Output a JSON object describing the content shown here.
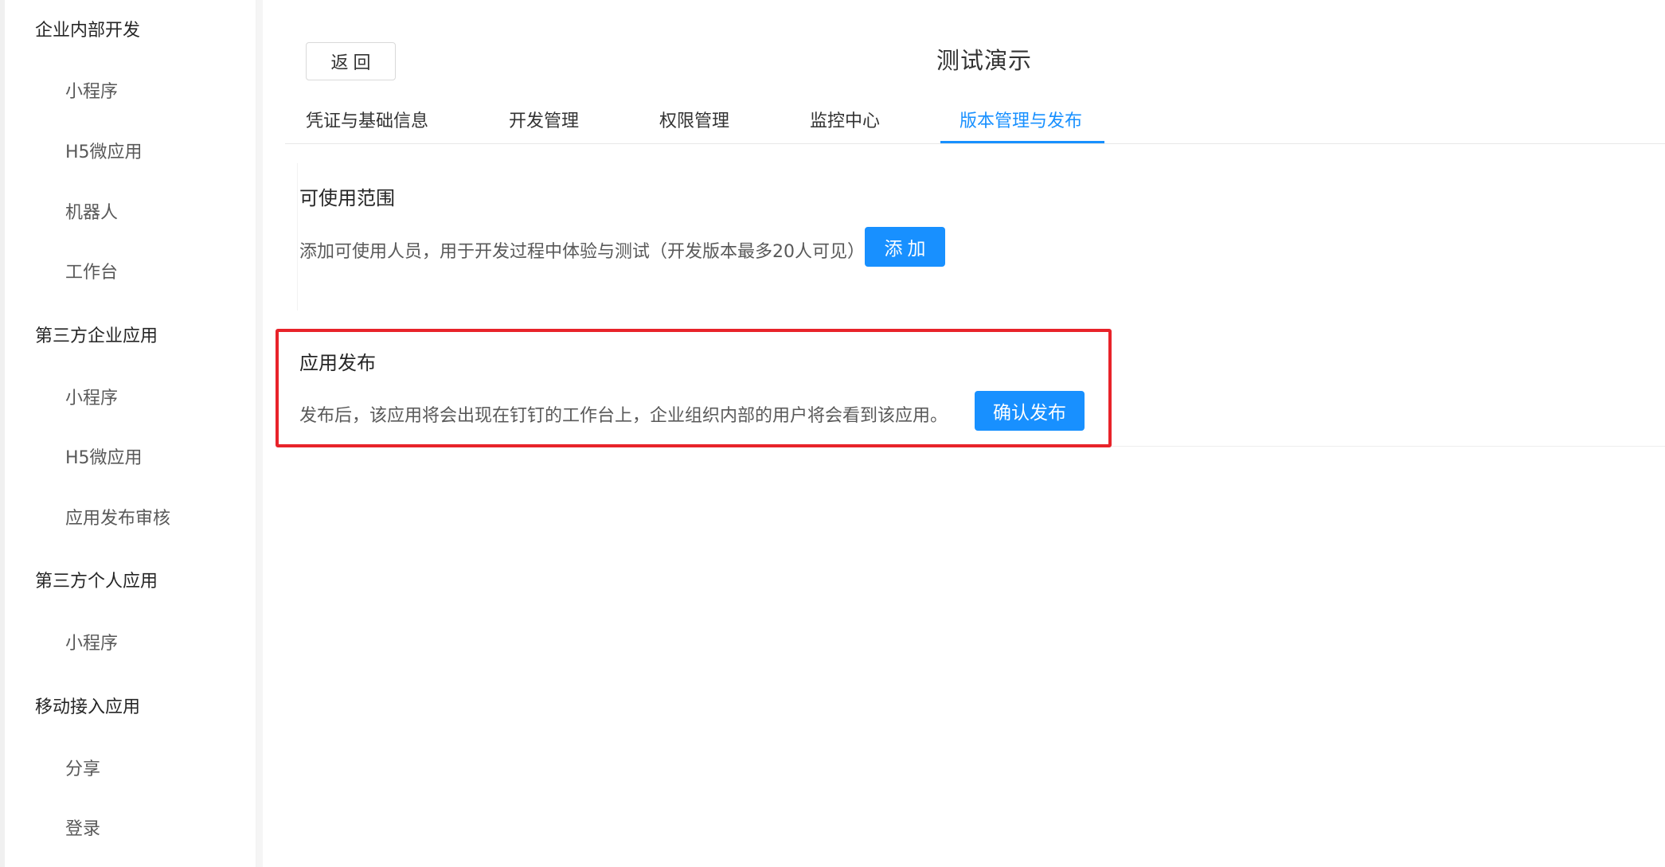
{
  "sidebar": {
    "groups": [
      {
        "label": "企业内部开发",
        "items": [
          "小程序",
          "H5微应用",
          "机器人",
          "工作台"
        ]
      },
      {
        "label": "第三方企业应用",
        "items": [
          "小程序",
          "H5微应用",
          "应用发布审核"
        ]
      },
      {
        "label": "第三方个人应用",
        "items": [
          "小程序"
        ]
      },
      {
        "label": "移动接入应用",
        "items": [
          "分享",
          "登录"
        ]
      }
    ]
  },
  "header": {
    "back_label": "返回",
    "title": "测试演示"
  },
  "tabs": [
    {
      "label": "凭证与基础信息",
      "active": false
    },
    {
      "label": "开发管理",
      "active": false
    },
    {
      "label": "权限管理",
      "active": false
    },
    {
      "label": "监控中心",
      "active": false
    },
    {
      "label": "版本管理与发布",
      "active": true
    }
  ],
  "usage_scope": {
    "title": "可使用范围",
    "description": "添加可使用人员，用于开发过程中体验与测试（开发版本最多20人可见）",
    "add_label": "添加"
  },
  "publish": {
    "title": "应用发布",
    "description": "发布后，该应用将会出现在钉钉的工作台上，企业组织内部的用户将会看到该应用。",
    "confirm_label": "确认发布"
  },
  "colors": {
    "primary": "#1890ff",
    "highlight_border": "#e8232a"
  }
}
